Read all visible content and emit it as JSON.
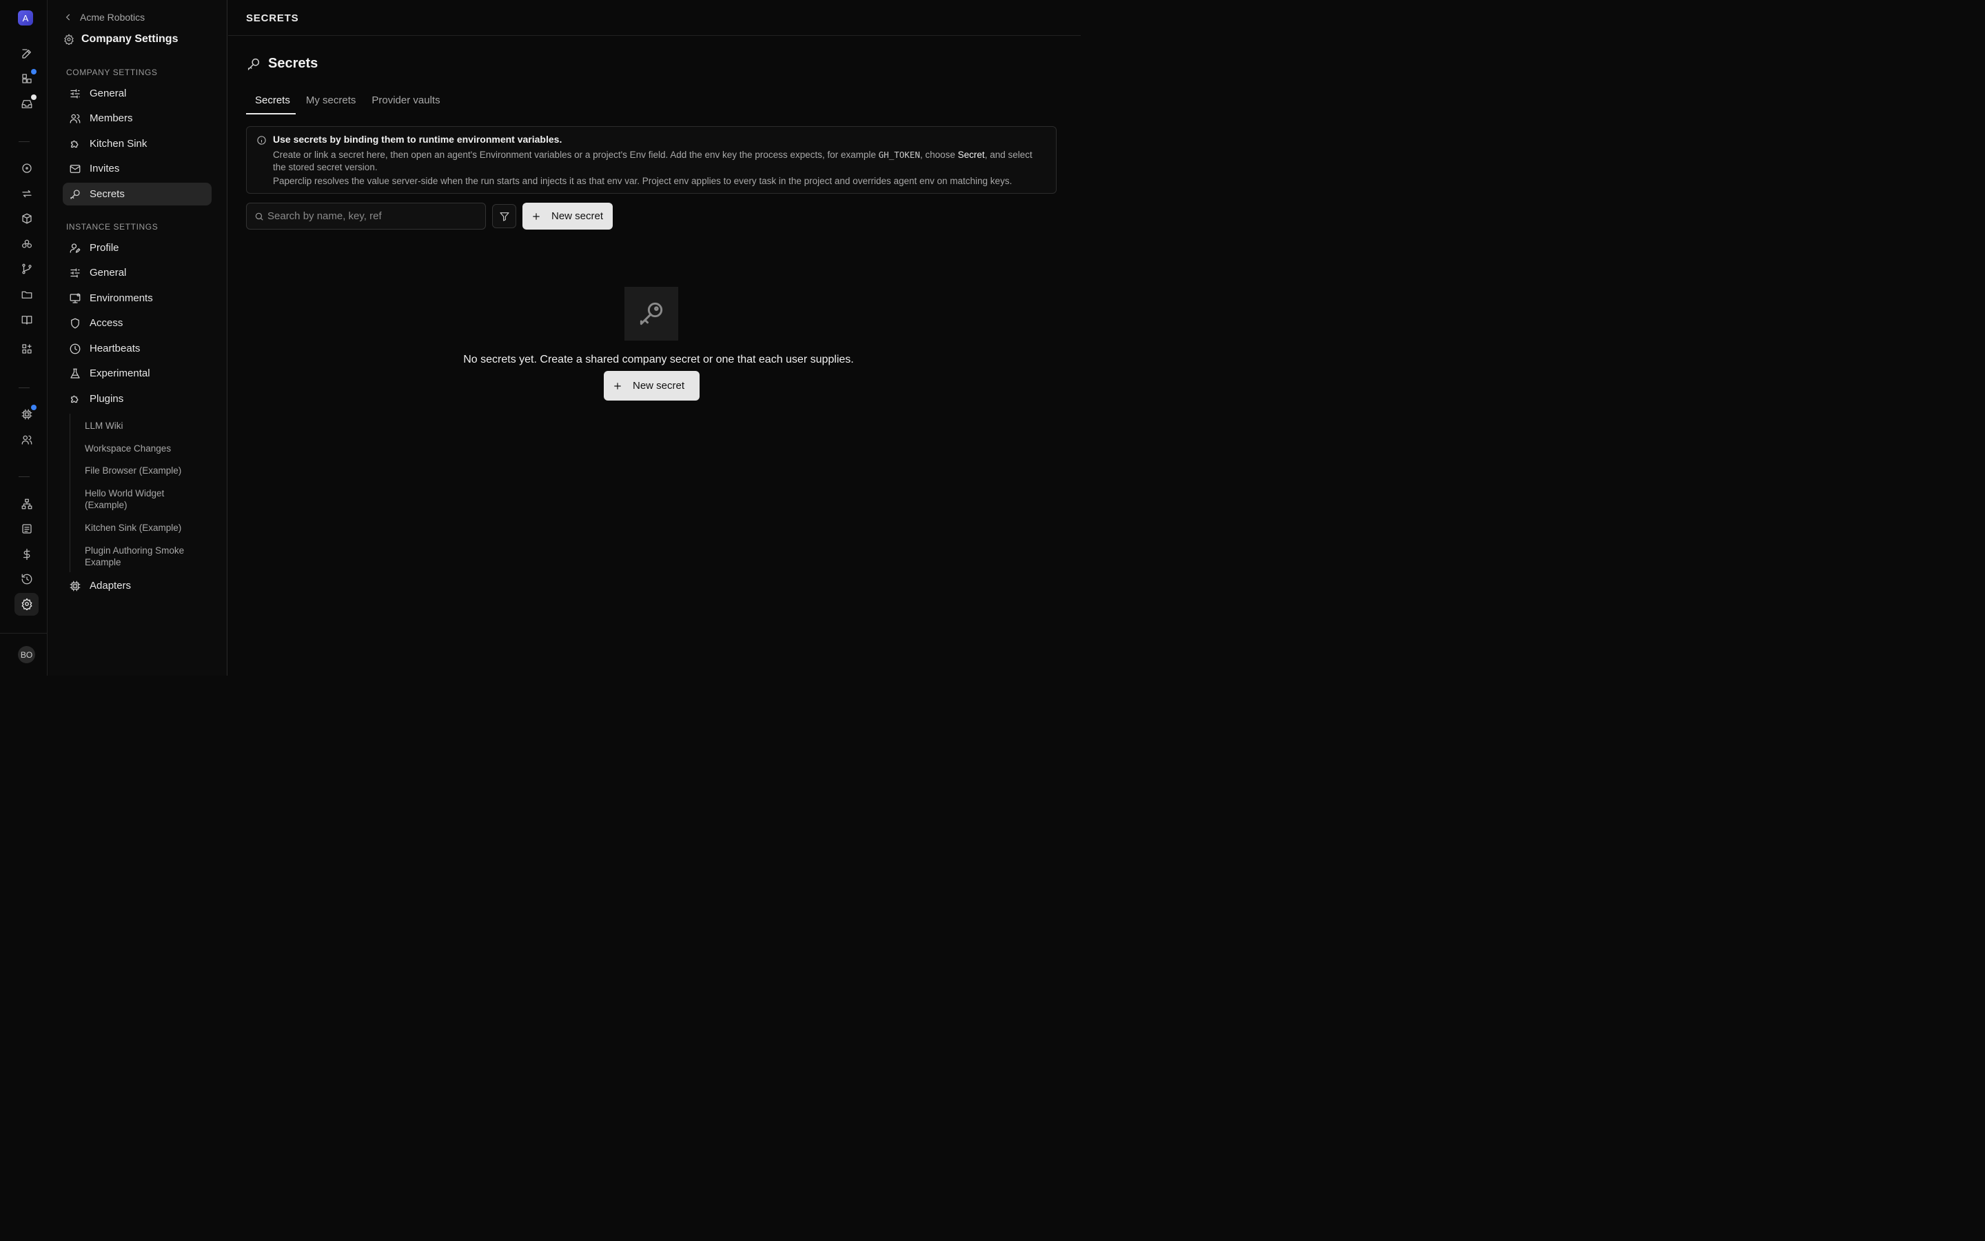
{
  "rail": {
    "logo_letter": "A",
    "avatar_initials": "BO",
    "notification_color": "#3b82f6",
    "icons": [
      "edit-icon",
      "dashboard-icon",
      "inbox-icon",
      "issues-icon",
      "routines-icon",
      "goals-icon",
      "agents-icon",
      "branch-icon",
      "folder-icon",
      "docs-icon",
      "apps-icon",
      "adapters-icon",
      "team-icon",
      "org-chart-icon",
      "logs-icon",
      "costs-icon",
      "history-icon",
      "settings-icon"
    ]
  },
  "sidebar": {
    "back_label": "Acme Robotics",
    "title": "Company Settings",
    "company_section_label": "COMPANY SETTINGS",
    "company_items": [
      {
        "label": "General",
        "icon": "sliders-icon"
      },
      {
        "label": "Members",
        "icon": "users-icon"
      },
      {
        "label": "Kitchen Sink",
        "icon": "puzzle-icon"
      },
      {
        "label": "Invites",
        "icon": "mail-icon"
      },
      {
        "label": "Secrets",
        "icon": "key-icon",
        "active": true
      }
    ],
    "instance_section_label": "INSTANCE SETTINGS",
    "instance_items": [
      {
        "label": "Profile",
        "icon": "user-edit-icon"
      },
      {
        "label": "General",
        "icon": "sliders-icon"
      },
      {
        "label": "Environments",
        "icon": "monitor-icon"
      },
      {
        "label": "Access",
        "icon": "shield-icon"
      },
      {
        "label": "Heartbeats",
        "icon": "clock-icon"
      },
      {
        "label": "Experimental",
        "icon": "flask-icon"
      },
      {
        "label": "Plugins",
        "icon": "puzzle-icon"
      }
    ],
    "plugin_items": [
      "LLM Wiki",
      "Workspace Changes",
      "File Browser (Example)",
      "Hello World Widget (Example)",
      "Kitchen Sink (Example)",
      "Plugin Authoring Smoke Example"
    ],
    "adapters_label": "Adapters"
  },
  "topbar": {
    "breadcrumb": "SECRETS"
  },
  "main": {
    "title": "Secrets",
    "tabs": [
      {
        "label": "Secrets",
        "active": true
      },
      {
        "label": "My secrets"
      },
      {
        "label": "Provider vaults"
      }
    ],
    "info": {
      "heading": "Use secrets by binding them to runtime environment variables.",
      "line1_a": "Create or link a secret here, then open an agent's Environment variables or a project's Env field. Add the env key the process expects, for example ",
      "line1_code": "GH_TOKEN",
      "line1_b": ", choose ",
      "line1_bold": "Secret",
      "line1_c": ", and select the stored secret version.",
      "line2": "Paperclip resolves the value server-side when the run starts and injects it as that env var. Project env applies to every task in the project and overrides agent env on matching keys."
    },
    "search": {
      "placeholder": "Search by name, key, ref",
      "value": ""
    },
    "new_secret_label": "New secret",
    "empty": {
      "message": "No secrets yet. Create a shared company secret or one that each user supplies.",
      "button_label": "New secret"
    }
  }
}
